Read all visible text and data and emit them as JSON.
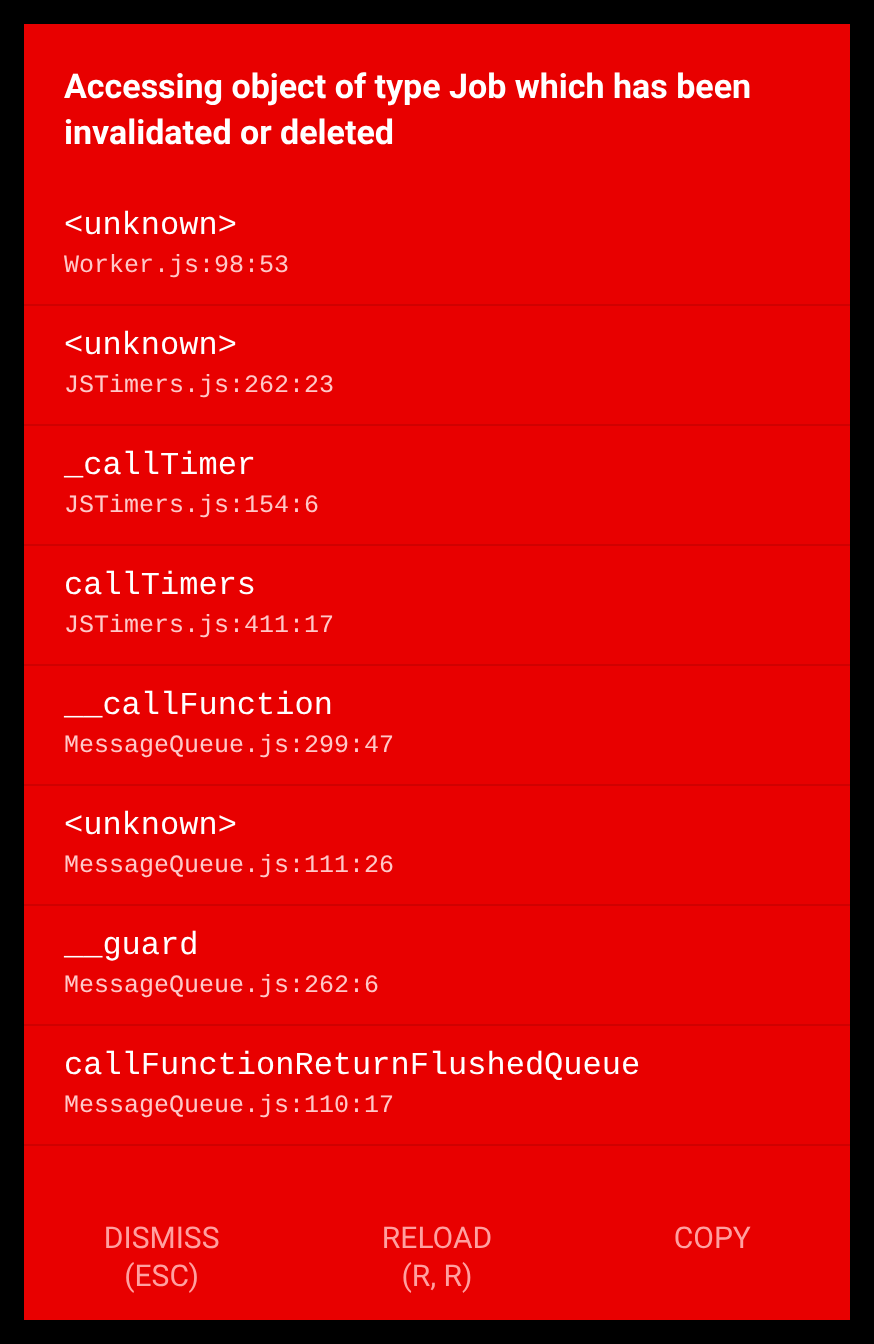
{
  "title": "Accessing object of type Job which has been invalidated or deleted",
  "frames": [
    {
      "method": "<unknown>",
      "location": "Worker.js:98:53"
    },
    {
      "method": "<unknown>",
      "location": "JSTimers.js:262:23"
    },
    {
      "method": "_callTimer",
      "location": "JSTimers.js:154:6"
    },
    {
      "method": "callTimers",
      "location": "JSTimers.js:411:17"
    },
    {
      "method": "__callFunction",
      "location": "MessageQueue.js:299:47"
    },
    {
      "method": "<unknown>",
      "location": "MessageQueue.js:111:26"
    },
    {
      "method": "__guard",
      "location": "MessageQueue.js:262:6"
    },
    {
      "method": "callFunctionReturnFlushedQueue",
      "location": "MessageQueue.js:110:17"
    }
  ],
  "buttons": [
    {
      "label": "DISMISS",
      "hint": "(ESC)"
    },
    {
      "label": "RELOAD",
      "hint": "(R, R)"
    },
    {
      "label": "COPY"
    }
  ]
}
